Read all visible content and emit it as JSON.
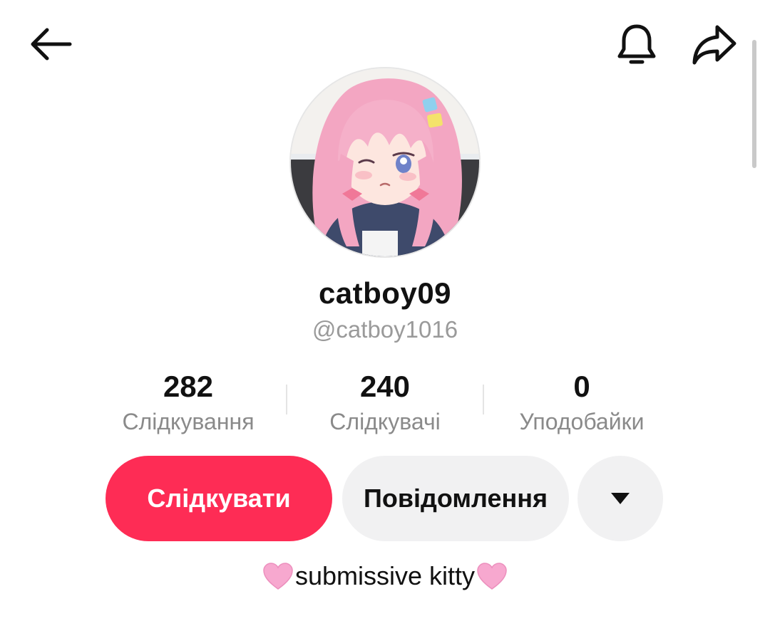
{
  "header": {
    "back_icon": "arrow-left-icon",
    "notify_icon": "bell-icon",
    "share_icon": "share-arrow-icon"
  },
  "profile": {
    "avatar_icon": "avatar-anime-girl-pink-hair",
    "display_name": "catboy09",
    "handle": "@catboy1016"
  },
  "stats": [
    {
      "value": "282",
      "label": "Слідкування"
    },
    {
      "value": "240",
      "label": "Слідкувачі"
    },
    {
      "value": "0",
      "label": "Уподобайки"
    }
  ],
  "actions": {
    "follow_label": "Слідкувати",
    "message_label": "Повідомлення",
    "more_icon": "caret-down-icon"
  },
  "bio": {
    "text": "submissive kitty",
    "emoji": "pink-heart-icon"
  },
  "colors": {
    "accent": "#fe2c55",
    "secondary_button": "#f1f1f2",
    "muted_text": "#8a8a8a"
  }
}
